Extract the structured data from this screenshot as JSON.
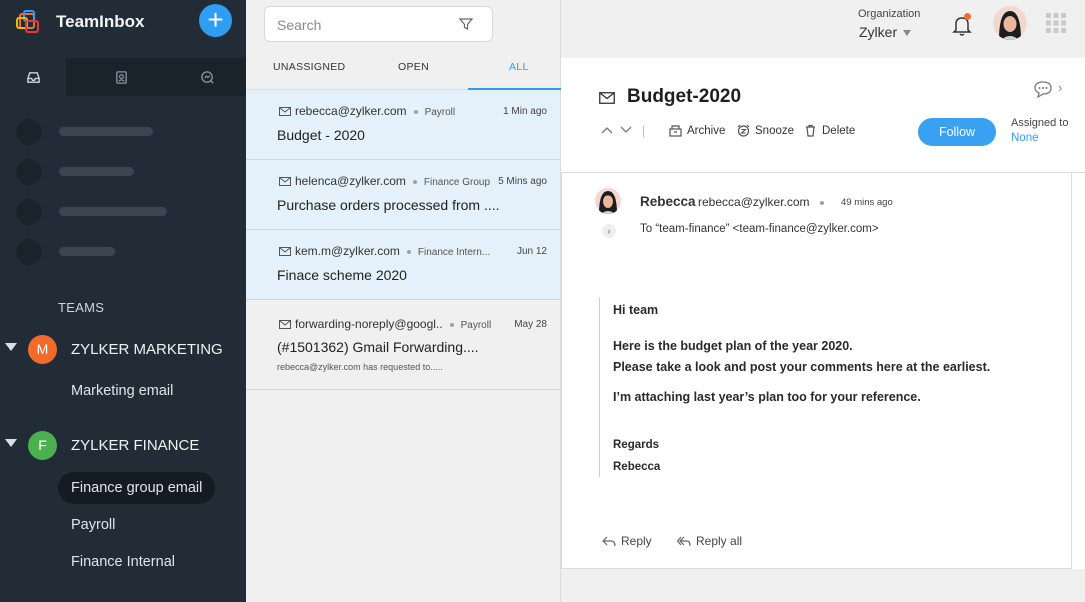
{
  "sidebar": {
    "app_name": "TeamInbox",
    "teams_label": "TEAMS",
    "teams": [
      {
        "initial": "M",
        "name": "ZYLKER MARKETING",
        "color": "#f26b2a",
        "items": [
          "Marketing email"
        ]
      },
      {
        "initial": "F",
        "name": "ZYLKER FINANCE",
        "color": "#4caf50",
        "items": [
          "Finance group email",
          "Payroll",
          "Finance Internal"
        ]
      }
    ]
  },
  "list": {
    "search_placeholder": "Search",
    "tabs": [
      "UNASSIGNED",
      "OPEN",
      "ALL"
    ],
    "active_tab": "ALL",
    "items": [
      {
        "from": "rebecca@zylker.com",
        "group": "Payroll",
        "time": "1 Min ago",
        "subject": "Budget - 2020",
        "preview": ""
      },
      {
        "from": "helenca@zylker.com",
        "group": "Finance Group",
        "time": "5 Mins ago",
        "subject": "Purchase orders processed from ....",
        "preview": ""
      },
      {
        "from": "kem.m@zylker.com",
        "group": "Finance Intern...",
        "time": "Jun 12",
        "subject": "Finace scheme 2020",
        "preview": ""
      },
      {
        "from": "forwarding-noreply@googl..",
        "group": "Payroll",
        "time": "May 28",
        "subject": "(#1501362) Gmail Forwarding....",
        "preview": "rebecca@zylker.com has requested to....."
      }
    ]
  },
  "topbar": {
    "org_label": "Organization",
    "org_name": "Zylker"
  },
  "mail": {
    "subject": "Budget-2020",
    "actions": {
      "archive": "Archive",
      "snooze": "Snooze",
      "delete": "Delete"
    },
    "follow_label": "Follow",
    "assigned_label": "Assigned to",
    "assigned_value": "None",
    "sender_name": "Rebecca",
    "sender_email": "rebecca@zylker.com",
    "sent_time": "49 mins ago",
    "to_line": "To “team-finance” <team-finance@zylker.com>",
    "body": {
      "greeting": "Hi team",
      "line1": "Here is the budget plan of the year 2020.",
      "line2": "Please take a look and post your comments here at the earliest.",
      "line3": "I’m attaching last year’s plan too for your reference.",
      "regards": "Regards",
      "signature": "Rebecca"
    },
    "reply_label": "Reply",
    "reply_all_label": "Reply all"
  },
  "colors": {
    "sidebar_bg": "#222c37",
    "accent": "#2f9df4",
    "selected_row": "#e4f1fb",
    "notification": "#f26b2a"
  }
}
